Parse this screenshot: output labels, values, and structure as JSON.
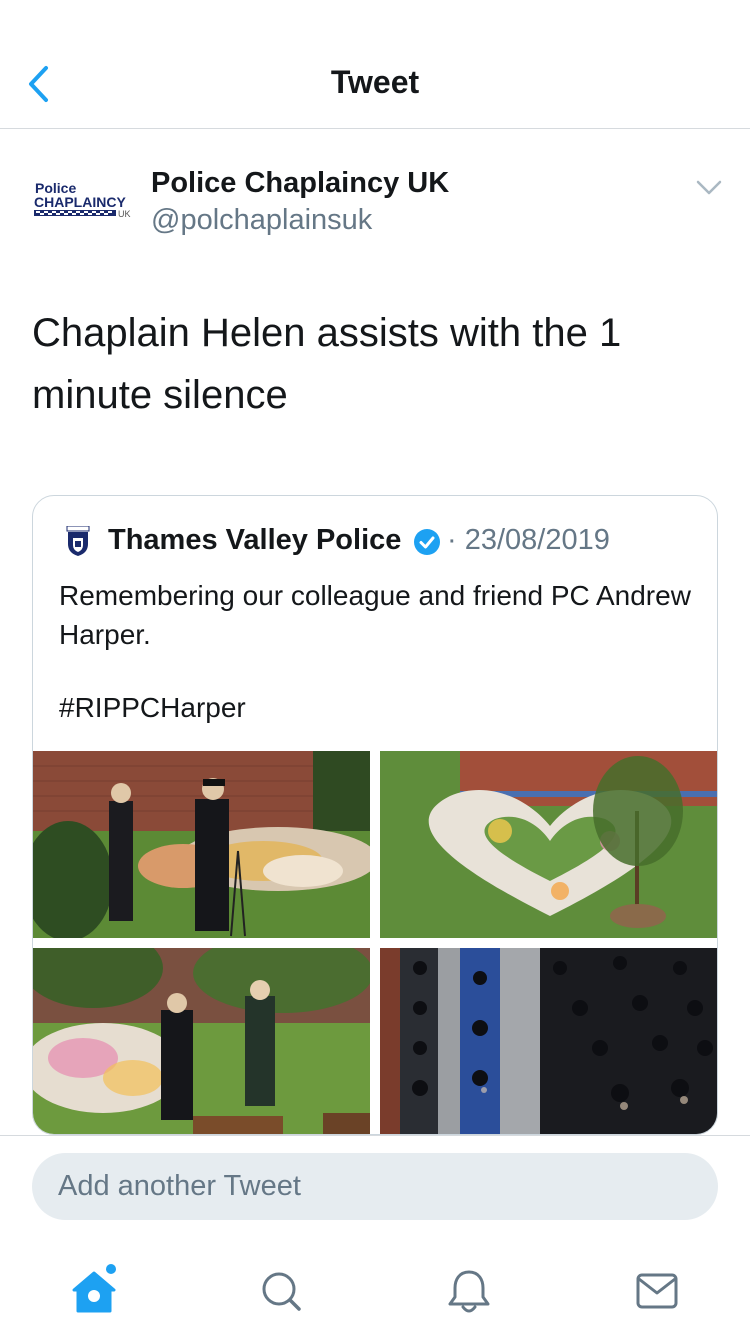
{
  "header": {
    "title": "Tweet"
  },
  "author": {
    "name": "Police Chaplaincy UK",
    "handle": "@polchaplainsuk",
    "avatar_text": "Police CHAPLAINCY UK"
  },
  "tweet": {
    "text": "Chaplain Helen assists with the 1 minute silence"
  },
  "quoted_tweet": {
    "author_name": "Thames Valley Police",
    "verified": true,
    "separator": "·",
    "date": "23/08/2019",
    "text": "Remembering our colleague and friend PC Andrew Harper.",
    "hashtag": "#RIPPCHarper",
    "photos": [
      "memorial-officers-speaking",
      "flower-heart-memorial",
      "officers-standing-at-flowers",
      "rows-of-officers"
    ]
  },
  "reply": {
    "placeholder": "Add another Tweet"
  },
  "tabs": [
    "home",
    "search",
    "notifications",
    "messages"
  ],
  "colors": {
    "accent": "#1da1f2",
    "text": "#14171a",
    "secondary": "#657786",
    "divider": "#d6dade",
    "input_bg": "#e6ecf0"
  }
}
